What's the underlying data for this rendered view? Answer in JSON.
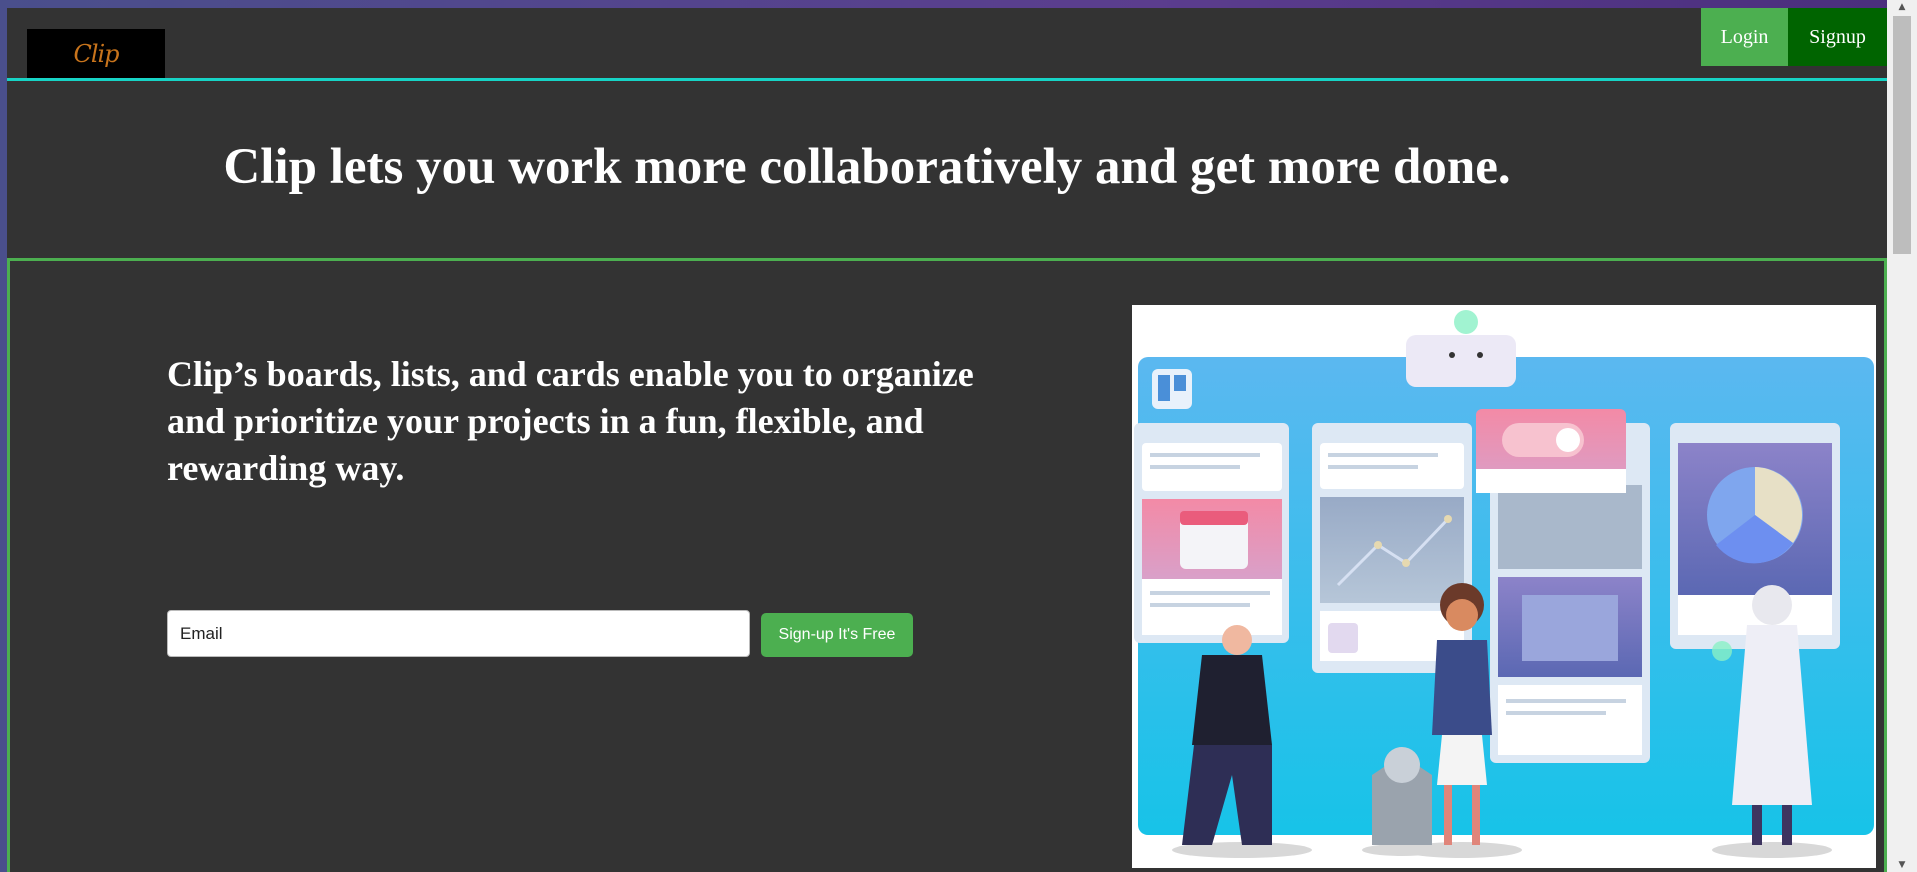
{
  "header": {
    "logo_text": "Clip",
    "login_label": "Login",
    "signup_label": "Signup"
  },
  "hero": {
    "headline": "Clip lets you work more collaboratively and get more done."
  },
  "feature": {
    "text": "Clip’s boards, lists, and cards enable you to organize and prioritize your projects in a fun, flexible, and rewarding way.",
    "email_placeholder": "Email",
    "cta_label": "Sign-up It's Free",
    "illustration_icon": "team-board-illustration"
  },
  "colors": {
    "page_bg": "#333333",
    "accent_green": "#4caf50",
    "dark_green": "#006400",
    "cyan_line": "#17d4c6",
    "logo_orange": "#c8741c"
  }
}
